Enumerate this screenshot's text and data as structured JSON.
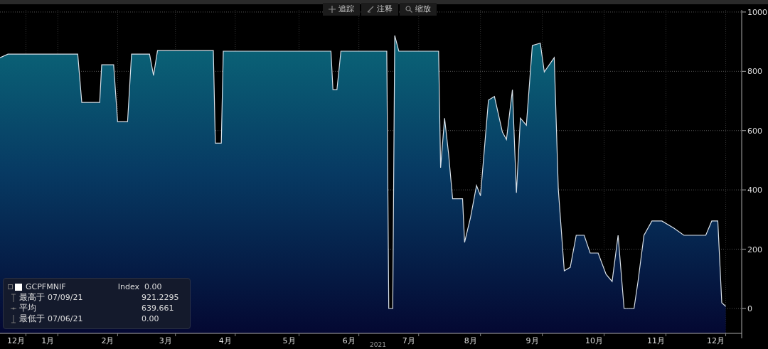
{
  "toolbar": [
    {
      "kind": "track",
      "label": "追踪"
    },
    {
      "kind": "annotate",
      "label": "注释"
    },
    {
      "kind": "zoom",
      "label": "缩放"
    }
  ],
  "chart_data": {
    "type": "area",
    "x": [
      "2020-12-23",
      "2020-12-27",
      "2021-01-31",
      "2021-02-02",
      "2021-02-11",
      "2021-02-12",
      "2021-02-18",
      "2021-02-20",
      "2021-02-25",
      "2021-02-27",
      "2021-03-08",
      "2021-03-10",
      "2021-03-12",
      "2021-04-09",
      "2021-04-10",
      "2021-04-13",
      "2021-04-14",
      "2021-06-07",
      "2021-06-08",
      "2021-06-10",
      "2021-06-12",
      "2021-07-05",
      "2021-07-06",
      "2021-07-08",
      "2021-07-09",
      "2021-07-11",
      "2021-07-31",
      "2021-08-01",
      "2021-08-03",
      "2021-08-05",
      "2021-08-07",
      "2021-08-12",
      "2021-08-13",
      "2021-08-16",
      "2021-08-19",
      "2021-08-21",
      "2021-08-25",
      "2021-08-28",
      "2021-09-01",
      "2021-09-03",
      "2021-09-06",
      "2021-09-08",
      "2021-09-10",
      "2021-09-13",
      "2021-09-16",
      "2021-09-20",
      "2021-09-22",
      "2021-09-27",
      "2021-09-29",
      "2021-10-02",
      "2021-10-05",
      "2021-10-08",
      "2021-10-12",
      "2021-10-15",
      "2021-10-19",
      "2021-10-23",
      "2021-10-26",
      "2021-10-29",
      "2021-11-01",
      "2021-11-06",
      "2021-11-08",
      "2021-11-11",
      "2021-11-15",
      "2021-11-20",
      "2021-11-26",
      "2021-12-01",
      "2021-12-12",
      "2021-12-15",
      "2021-12-18",
      "2021-12-20",
      "2021-12-22"
    ],
    "series": [
      {
        "name": "GCPFMNIF",
        "color": "#d8e0e8",
        "values": [
          846,
          858,
          858,
          695,
          695,
          822,
          822,
          630,
          630,
          858,
          858,
          786,
          870,
          870,
          558,
          558,
          868,
          868,
          738,
          738,
          868,
          868,
          0,
          0,
          921,
          868,
          868,
          475,
          642,
          522,
          370,
          370,
          223,
          307,
          415,
          380,
          703,
          715,
          595,
          570,
          738,
          390,
          642,
          618,
          887,
          895,
          798,
          846,
          403,
          127,
          139,
          247,
          247,
          187,
          187,
          115,
          91,
          247,
          0,
          0,
          91,
          247,
          295,
          295,
          271,
          247,
          247,
          295,
          295,
          19,
          7
        ]
      }
    ],
    "xlim": [
      "2020-12-23",
      "2021-12-30"
    ],
    "ylim": [
      -84,
      1007
    ],
    "xticks": [
      {
        "value": "2020-12-31",
        "label": "12月"
      },
      {
        "value": "2021-01-16",
        "label": "1月"
      },
      {
        "value": "2021-02-15",
        "label": "2月"
      },
      {
        "value": "2021-03-16",
        "label": "3月"
      },
      {
        "value": "2021-04-15",
        "label": "4月"
      },
      {
        "value": "2021-05-17",
        "label": "5月"
      },
      {
        "value": "2021-06-16",
        "label": "6月"
      },
      {
        "value": "2021-07-16",
        "label": "7月"
      },
      {
        "value": "2021-08-16",
        "label": "8月"
      },
      {
        "value": "2021-09-16",
        "label": "9月"
      },
      {
        "value": "2021-10-17",
        "label": "10月"
      },
      {
        "value": "2021-11-17",
        "label": "11月"
      },
      {
        "value": "2021-12-17",
        "label": "12月"
      }
    ],
    "yticks": [
      0,
      200,
      400,
      600,
      800,
      1000
    ],
    "xlabel": "2021",
    "grid": true
  },
  "legend": {
    "unit_label": "Index",
    "value": "0.00",
    "rows": [
      {
        "kind": "max",
        "label": "最高于",
        "date": "07/09/21",
        "value": "921.2295"
      },
      {
        "kind": "avg",
        "label": "平均",
        "value": "639.661"
      },
      {
        "kind": "min",
        "label": "最低于",
        "date": "07/06/21",
        "value": "0.00"
      }
    ]
  }
}
